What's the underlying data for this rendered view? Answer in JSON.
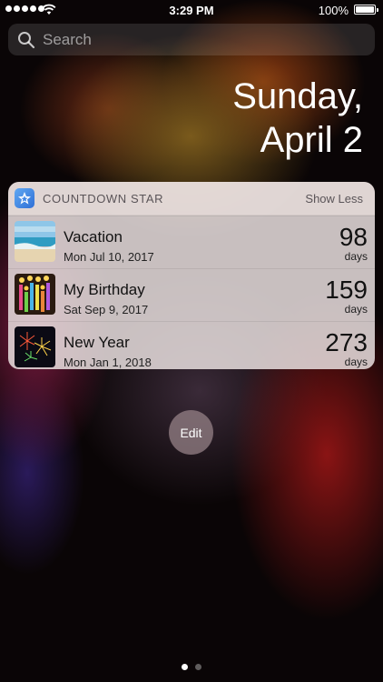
{
  "status_bar": {
    "time": "3:29 PM",
    "battery": "100%"
  },
  "search": {
    "placeholder": "Search"
  },
  "date": {
    "weekday": "Sunday,",
    "month_day": "April 2"
  },
  "widget": {
    "app_name": "COUNTDOWN STAR",
    "toggle_label": "Show Less",
    "accent_color": "#2f6fd6",
    "events": [
      {
        "title": "Vacation",
        "date": "Mon Jul 10, 2017",
        "count": "98",
        "unit": "days",
        "thumbnail_icon": "beach-photo"
      },
      {
        "title": "My Birthday",
        "date": "Sat Sep 9, 2017",
        "count": "159",
        "unit": "days",
        "thumbnail_icon": "birthday-candles-photo"
      },
      {
        "title": "New Year",
        "date": "Mon Jan 1, 2018",
        "count": "273",
        "unit": "days",
        "thumbnail_icon": "fireworks-photo"
      }
    ]
  },
  "edit": {
    "label": "Edit"
  },
  "pages": {
    "count": 2,
    "current": 1
  }
}
